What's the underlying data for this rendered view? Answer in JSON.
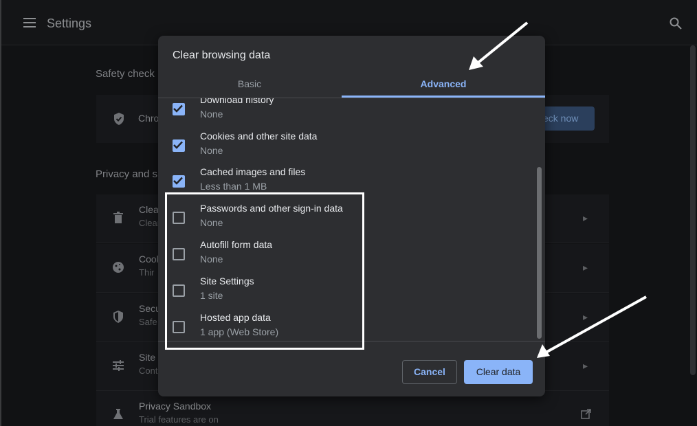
{
  "background": {
    "topbar": {
      "title": "Settings"
    },
    "safety_check": {
      "section_title": "Safety check",
      "row_text": "Chro",
      "button_label": "eck now"
    },
    "privacy": {
      "section_title": "Privacy and s",
      "rows": [
        {
          "title": "Clear",
          "subtitle": "Clear",
          "icon": "trash-icon"
        },
        {
          "title": "Cook",
          "subtitle": "Thir",
          "icon": "cookie-icon"
        },
        {
          "title": "Secu",
          "subtitle": "Safe",
          "icon": "shield-icon"
        },
        {
          "title": "Site S",
          "subtitle": "Cont",
          "icon": "tune-icon"
        },
        {
          "title": "Privacy Sandbox",
          "subtitle": "Trial features are on",
          "icon": "flask-icon"
        }
      ]
    }
  },
  "dialog": {
    "title": "Clear browsing data",
    "tabs": {
      "basic": "Basic",
      "advanced": "Advanced",
      "selected": "Advanced"
    },
    "items": [
      {
        "label": "Download history",
        "sublabel": "None",
        "checked": true
      },
      {
        "label": "Cookies and other site data",
        "sublabel": "None",
        "checked": true
      },
      {
        "label": "Cached images and files",
        "sublabel": "Less than 1 MB",
        "checked": true
      },
      {
        "label": "Passwords and other sign-in data",
        "sublabel": "None",
        "checked": false
      },
      {
        "label": "Autofill form data",
        "sublabel": "None",
        "checked": false
      },
      {
        "label": "Site Settings",
        "sublabel": "1 site",
        "checked": false
      },
      {
        "label": "Hosted app data",
        "sublabel": "1 app (Web Store)",
        "checked": false
      }
    ],
    "buttons": {
      "cancel": "Cancel",
      "clear": "Clear data"
    }
  },
  "colors": {
    "accent": "#8ab4f8",
    "dialog_bg": "#2d2e31",
    "annotation": "#ffffff"
  }
}
